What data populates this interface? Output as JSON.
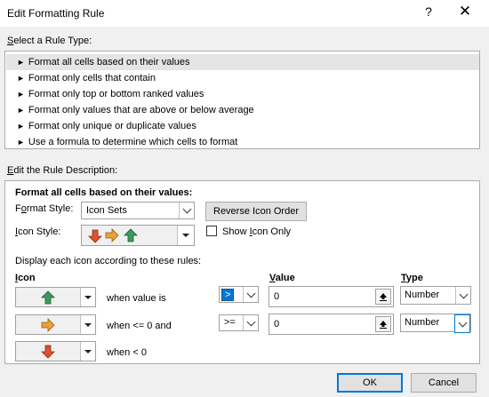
{
  "dialog": {
    "title": "Edit Formatting Rule",
    "help": "?",
    "close": "✕"
  },
  "rule_type": {
    "label": "Select a Rule Type:",
    "items": [
      "Format all cells based on their values",
      "Format only cells that contain",
      "Format only top or bottom ranked values",
      "Format only values that are above or below average",
      "Format only unique or duplicate values",
      "Use a formula to determine which cells to format"
    ],
    "selected_index": 0
  },
  "description": {
    "label": "Edit the Rule Description:",
    "heading": "Format all cells based on their values:",
    "format_style_label": "Format Style:",
    "format_style_value": "Icon Sets",
    "reverse_button": "Reverse Icon Order",
    "icon_style_label": "Icon Style:",
    "show_icon_only": "Show Icon Only",
    "show_icon_only_checked": false,
    "rules_label": "Display each icon according to these rules:",
    "col_icon": "Icon",
    "col_value": "Value",
    "col_type": "Type",
    "rows": [
      {
        "icon": "green-up-arrow-icon",
        "text": "when value is",
        "op": ">",
        "value": "0",
        "type": "Number"
      },
      {
        "icon": "yellow-right-arrow-icon",
        "text": "when <= 0 and",
        "op": ">=",
        "value": "0",
        "type": "Number"
      },
      {
        "icon": "red-down-arrow-icon",
        "text": "when < 0"
      }
    ]
  },
  "buttons": {
    "ok": "OK",
    "cancel": "Cancel"
  },
  "colors": {
    "accent": "#0078d7",
    "up": "#3a9a5b",
    "right": "#e8a23b",
    "down": "#d9532c"
  }
}
